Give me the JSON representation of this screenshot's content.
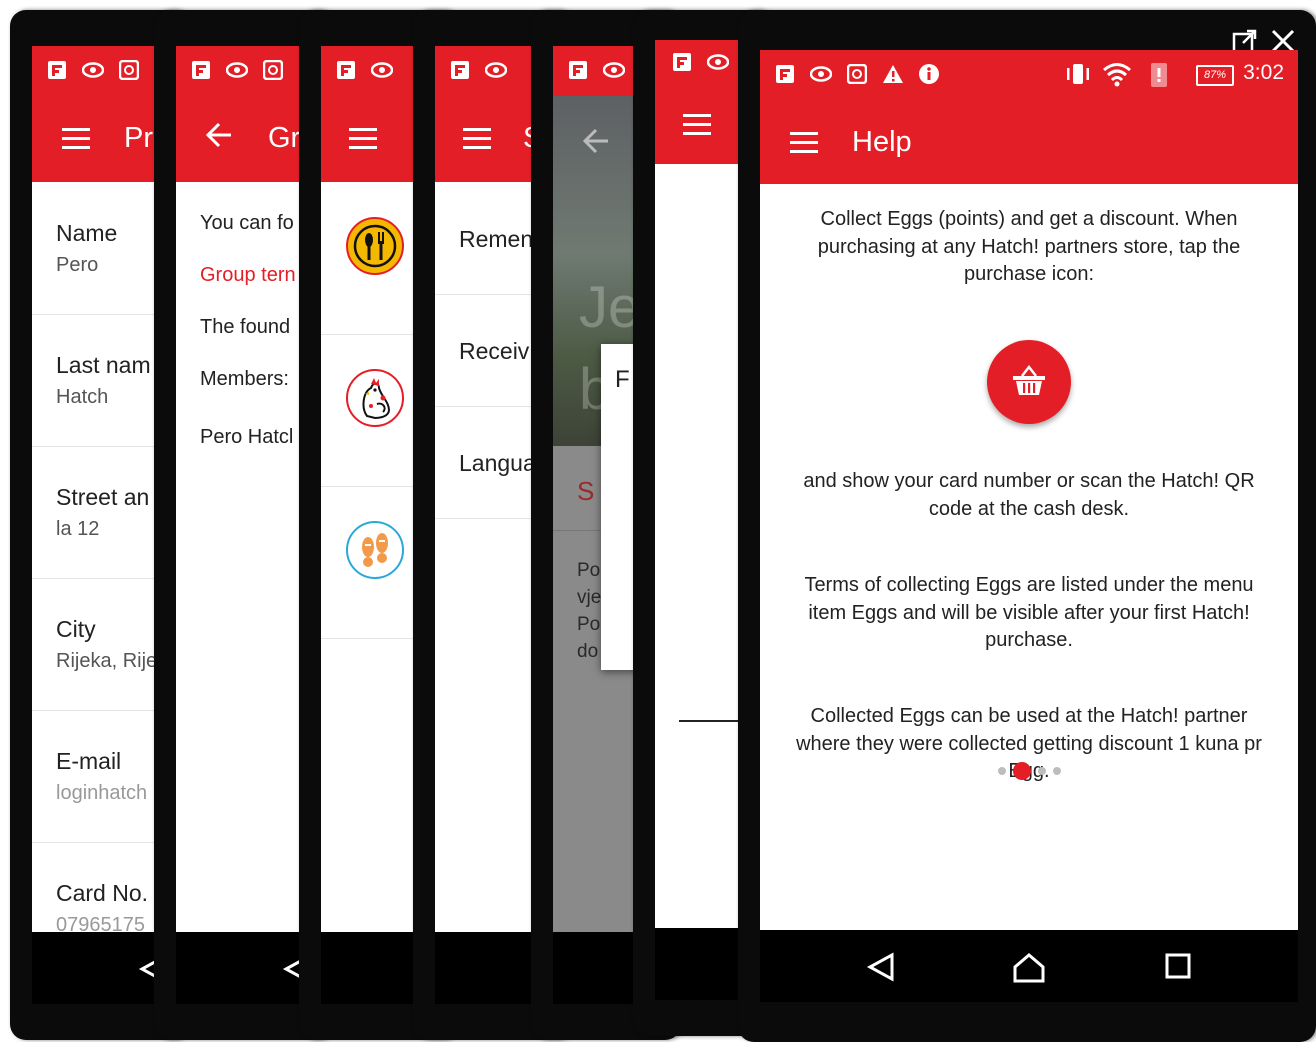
{
  "phones": {
    "profile": {
      "title": "Pr",
      "fields": [
        {
          "label": "Name",
          "value": "Pero"
        },
        {
          "label": "Last nam",
          "value": "Hatch"
        },
        {
          "label": "Street an",
          "value": "la 12"
        },
        {
          "label": "City",
          "value": "Rijeka, Rije"
        },
        {
          "label": "E-mail",
          "value": "loginhatch"
        },
        {
          "label": "Card No.",
          "value": "07965175"
        }
      ]
    },
    "group": {
      "title": "Gr",
      "lines": [
        "You can fo",
        "Group tern",
        "The found",
        "Members:",
        "Pero Hatcl"
      ]
    },
    "categories": {
      "icons": [
        "restaurant-icon",
        "chicken-icon",
        "footprints-icon"
      ]
    },
    "settings": {
      "title": "S",
      "items": [
        "Remen",
        "Receiv",
        "Langua"
      ]
    },
    "partner": {
      "overlay_text": "Je",
      "overlay_text2": "b",
      "dialog_letter": "F",
      "section_letter": "S",
      "body_lines": [
        "Po",
        "vje",
        "Po",
        "do"
      ]
    },
    "help": {
      "title": "Help",
      "status": {
        "battery": "87%",
        "time": "3:02"
      },
      "paragraphs": [
        "Collect Eggs (points) and get a discount. When purchasing at any Hatch! partners store, tap the purchase icon:",
        "and show your card number or scan the Hatch! QR code at the cash desk.",
        "Terms of collecting Eggs are listed under the menu item Eggs and will be visible after your first Hatch! purchase.",
        "Collected Eggs can be used at the Hatch! partner where they were collected getting discount 1 kuna pr Egg."
      ],
      "page_indicator": {
        "count": 4,
        "active": 2
      }
    }
  },
  "colors": {
    "brand_red": "#e41e26",
    "frame": "#0b0b0b"
  },
  "icons": [
    "flipboard-icon",
    "eye-icon",
    "hatch-icon",
    "warning-icon",
    "info-icon",
    "vibrate-icon",
    "wifi-icon",
    "battery-icon",
    "external-window-icon",
    "close-icon",
    "back-nav-icon",
    "home-nav-icon",
    "recents-nav-icon",
    "basket-icon",
    "menu-icon",
    "back-arrow-icon"
  ]
}
